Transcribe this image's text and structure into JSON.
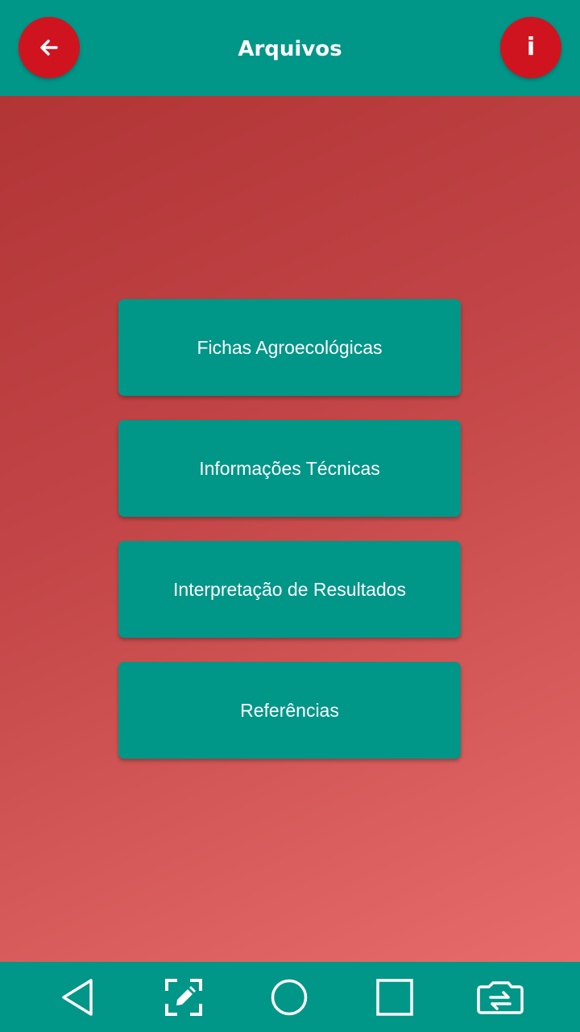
{
  "header": {
    "title": "Arquivos",
    "back_icon": "arrow-left-icon",
    "info_label": "i",
    "accent_color": "#d0141f",
    "bar_color": "#009688"
  },
  "menu": {
    "items": [
      {
        "label": "Fichas Agroecológicas"
      },
      {
        "label": "Informações Técnicas"
      },
      {
        "label": "Interpretação de Resultados"
      },
      {
        "label": "Referências"
      }
    ]
  },
  "navbar": {
    "icons": [
      "back-triangle-icon",
      "screenshot-edit-icon",
      "home-circle-icon",
      "recents-square-icon",
      "switch-camera-icon"
    ]
  }
}
